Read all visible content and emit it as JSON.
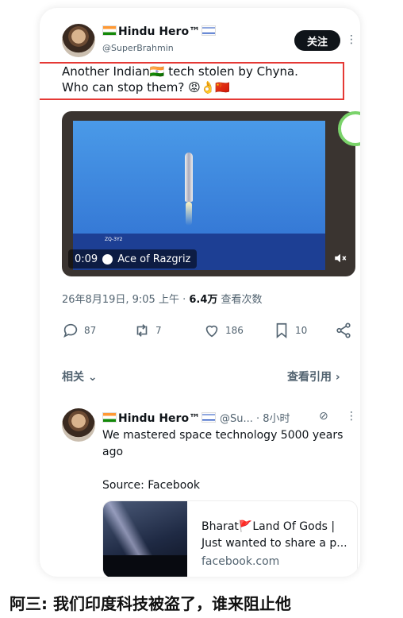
{
  "post": {
    "author_name": "Hindu Hero™",
    "handle": "@SuperBrahmin",
    "follow_label": "关注",
    "text_line1": "Another Indian🇮🇳 tech stolen by Chyna.",
    "text_line2": "Who can stop them? 😡👌🇨🇳",
    "video": {
      "time": "0:09",
      "channel": "Ace of Razgriz",
      "overlay_label": "ZQ-3Y2"
    },
    "date": "26年8月19日, 9:05 上午 · ",
    "views_count": "6.4万",
    "views_label": " 查看次数",
    "actions": {
      "replies": "87",
      "retweets": "7",
      "likes": "186",
      "bookmarks": "10"
    },
    "related_label": "相关",
    "quotes_label": "查看引用"
  },
  "reply": {
    "author_name": "Hindu Hero™",
    "handle_time": "@Su... · 8小时",
    "text": "We mastered space technology 5000 years ago",
    "source": "Source: Facebook",
    "link_title": "Bharat🚩Land Of Gods | Just wanted to share a p...",
    "link_domain": "facebook.com"
  },
  "caption": "阿三: 我们印度科技被盗了，谁来阻止他",
  "colors": {
    "highlight_box": "#e53935",
    "follow_button": "#0f1419",
    "secondary_text": "#536471"
  }
}
